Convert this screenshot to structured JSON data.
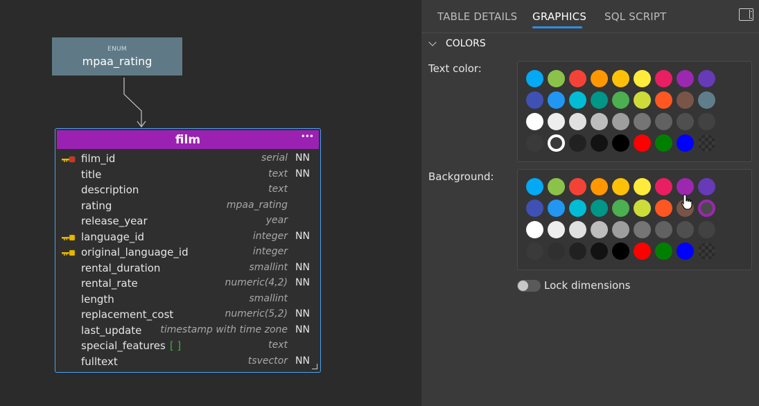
{
  "diagram": {
    "enum": {
      "type_label": "ENUM",
      "name": "mpaa_rating"
    },
    "table": {
      "name": "film",
      "menu_icon": "ellipsis-icon",
      "columns": [
        {
          "name": "film_id",
          "type": "serial",
          "nn": "NN",
          "key": "pk"
        },
        {
          "name": "title",
          "type": "text",
          "nn": "NN",
          "key": ""
        },
        {
          "name": "description",
          "type": "text",
          "nn": "",
          "key": ""
        },
        {
          "name": "rating",
          "type": "mpaa_rating",
          "nn": "",
          "key": ""
        },
        {
          "name": "release_year",
          "type": "year",
          "nn": "",
          "key": ""
        },
        {
          "name": "language_id",
          "type": "integer",
          "nn": "NN",
          "key": "fk"
        },
        {
          "name": "original_language_id",
          "type": "integer",
          "nn": "",
          "key": "fk"
        },
        {
          "name": "rental_duration",
          "type": "smallint",
          "nn": "NN",
          "key": ""
        },
        {
          "name": "rental_rate",
          "type": "numeric(4,2)",
          "nn": "NN",
          "key": ""
        },
        {
          "name": "length",
          "type": "smallint",
          "nn": "",
          "key": ""
        },
        {
          "name": "replacement_cost",
          "type": "numeric(5,2)",
          "nn": "NN",
          "key": ""
        },
        {
          "name": "last_update",
          "type": "timestamp with time zone",
          "nn": "NN",
          "key": ""
        },
        {
          "name": "special_features",
          "array": "[ ]",
          "type": "text",
          "nn": "",
          "key": ""
        },
        {
          "name": "fulltext",
          "type": "tsvector",
          "nn": "NN",
          "key": ""
        }
      ]
    }
  },
  "panel": {
    "tabs": [
      {
        "label": "TABLE DETAILS",
        "active": false
      },
      {
        "label": "GRAPHICS",
        "active": true
      },
      {
        "label": "SQL SCRIPT",
        "active": false
      }
    ],
    "section_title": "COLORS",
    "text_color_label": "Text color:",
    "background_label": "Background:",
    "lock_label": "Lock dimensions",
    "lock_on": false,
    "accent": "#2d8fe6",
    "palette": [
      [
        "#03a9f4",
        "#8bc34a",
        "#f44336",
        "#ff9800",
        "#ffc107",
        "#ffeb3b",
        "#e91e63",
        "#9c27b0",
        "#673ab7"
      ],
      [
        "#3f51b5",
        "#2196f3",
        "#00bcd4",
        "#009688",
        "#4caf50",
        "#cddc39",
        "#ff5722",
        "#795548",
        "#607d8b"
      ],
      [
        "#ffffff",
        "#eeeeee",
        "#e0e0e0",
        "#bdbdbd",
        "#9e9e9e",
        "#757575",
        "#616161",
        "#4f4f4f",
        "#424242"
      ],
      [
        "#3a3a3a",
        "#303030",
        "#212121",
        "#121212",
        "#000000",
        "#ff0000",
        "#008000",
        "#0000ff",
        "pattern"
      ]
    ],
    "text_selected": "3-1",
    "background_selected": "1-8"
  }
}
